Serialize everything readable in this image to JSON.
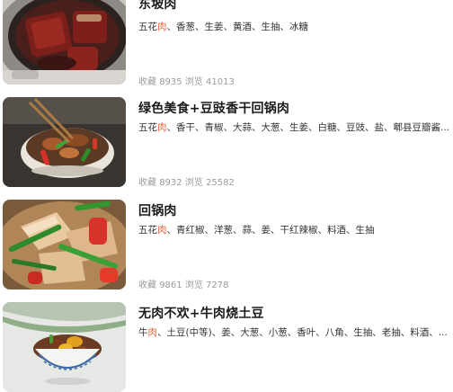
{
  "recipes": [
    {
      "title": "东坡肉",
      "ingredients_hl": "五花肉",
      "ingredients_hl_pre": "五花",
      "ingredients_hl_word": "肉",
      "ingredients_rest": "、香葱、生姜、黄酒、生抽、冰糖",
      "favorites_label": "收藏",
      "favorites": "8935",
      "views_label": "浏览",
      "views": "41013",
      "image_icon": "braised-pork-in-pot-image"
    },
    {
      "title": "绿色美食+豆豉香干回锅肉",
      "ingredients_hl_pre": "五花",
      "ingredients_hl_word": "肉",
      "ingredients_rest": "、香干、青椒、大蒜、大葱、生姜、白糖、豆豉、盐、郫县豆瓣酱...",
      "favorites_label": "收藏",
      "favorites": "8932",
      "views_label": "浏览",
      "views": "25582",
      "image_icon": "pork-stirfry-bowl-image"
    },
    {
      "title": "回锅肉",
      "ingredients_hl_pre": "五花",
      "ingredients_hl_word": "肉",
      "ingredients_rest": "、青红椒、洋葱、蒜、姜、干红辣椒、料酒、生抽",
      "favorites_label": "收藏",
      "favorites": "9861",
      "views_label": "浏览",
      "views": "7278",
      "image_icon": "twice-cooked-pork-plate-image"
    },
    {
      "title": "无肉不欢+牛肉烧土豆",
      "ingredients_hl_pre": "牛",
      "ingredients_hl_word": "肉",
      "ingredients_rest": "、土豆(中等)、姜、大葱、小葱、香叶、八角、生抽、老抽、料酒、...",
      "image_icon": "beef-potato-bowl-image"
    }
  ],
  "colors": {
    "highlight": "#e8603c",
    "title": "#1a1a1a",
    "meta": "#9b9b9b"
  }
}
